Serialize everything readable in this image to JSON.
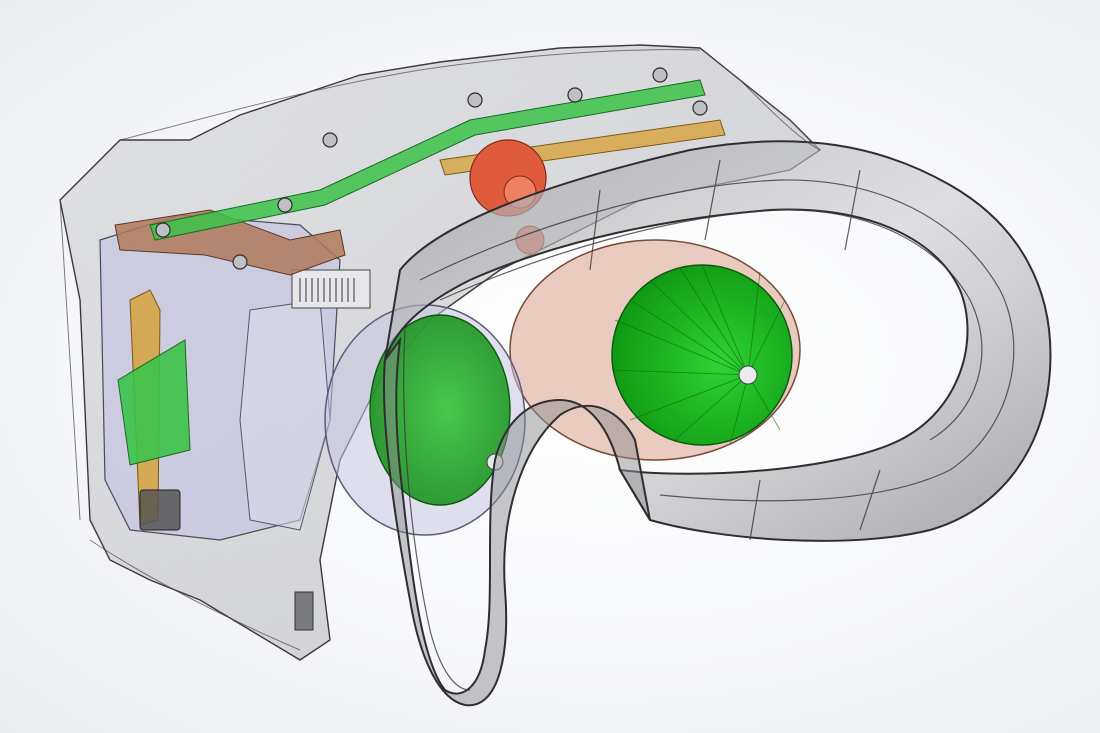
{
  "scene": {
    "subject": "",
    "render_style": "transparent-shaded-cad",
    "colors": {
      "background": "#f4f5f7",
      "shell_fill": "#c9cacd",
      "shell_edge": "#3a3a3c",
      "facial_interface": "#8e8f92",
      "lens_green": "#17b51b",
      "lens_green_dark": "#0d7a10",
      "lens_ring_pink": "#e3b9aa",
      "gear_red": "#e05a3c",
      "pcb_green": "#3cc24a",
      "flex_copper": "#b07a5a",
      "display_lavender": "#c7c6e0",
      "bracket_gold": "#d6a23c"
    },
    "parts": [
      {
        "name": "outer-shell",
        "color": "shell_fill"
      },
      {
        "name": "facial-interface-gasket",
        "color": "facial_interface"
      },
      {
        "name": "nose-bridge",
        "color": "facial_interface"
      },
      {
        "name": "left-lens",
        "color": "lens_green"
      },
      {
        "name": "right-lens",
        "color": "lens_green"
      },
      {
        "name": "right-lens-ring",
        "color": "lens_ring_pink"
      },
      {
        "name": "ipd-adjust-gear",
        "color": "gear_red"
      },
      {
        "name": "top-pcb-strip",
        "color": "pcb_green"
      },
      {
        "name": "side-pcb",
        "color": "pcb_green"
      },
      {
        "name": "flex-cable",
        "color": "flex_copper"
      },
      {
        "name": "display-module",
        "color": "display_lavender"
      },
      {
        "name": "mounting-bracket",
        "color": "bracket_gold"
      },
      {
        "name": "usb-connector",
        "color": "shell_edge"
      }
    ]
  }
}
